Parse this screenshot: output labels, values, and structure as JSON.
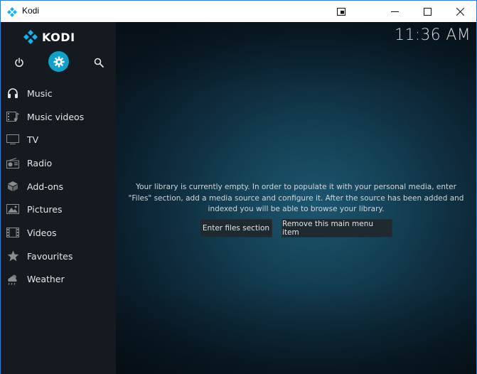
{
  "window": {
    "title": "Kodi",
    "controls": {
      "extra_icon": "picture-in-picture-icon",
      "minimize_icon": "minimize-icon",
      "maximize_icon": "maximize-icon",
      "close_icon": "close-icon"
    }
  },
  "header": {
    "logo_text": "KODI",
    "clock": "11:36 AM"
  },
  "top_icons": [
    {
      "name": "power-icon"
    },
    {
      "name": "settings-gear-icon",
      "active": true
    },
    {
      "name": "search-icon"
    }
  ],
  "menu": {
    "items": [
      {
        "label": "Music",
        "icon": "headphones-icon"
      },
      {
        "label": "Music videos",
        "icon": "music-video-icon"
      },
      {
        "label": "TV",
        "icon": "tv-icon"
      },
      {
        "label": "Radio",
        "icon": "radio-icon"
      },
      {
        "label": "Add-ons",
        "icon": "addons-box-icon"
      },
      {
        "label": "Pictures",
        "icon": "pictures-icon"
      },
      {
        "label": "Videos",
        "icon": "film-icon"
      },
      {
        "label": "Favourites",
        "icon": "star-icon"
      },
      {
        "label": "Weather",
        "icon": "weather-cloud-icon"
      }
    ]
  },
  "main": {
    "message_lines": [
      "Your library is currently empty. In order to populate it with your personal media, enter",
      "\"Files\" section, add a media source and configure it. After the source has been added and",
      "indexed you will be able to browse your library."
    ],
    "enter_files_button": "Enter files section",
    "remove_item_button": "Remove this main menu item"
  },
  "colors": {
    "accent": "#12a0c7",
    "sidebar_bg": "#141a20",
    "main_bg_center": "#1d5670",
    "text": "#e6e6e6"
  }
}
